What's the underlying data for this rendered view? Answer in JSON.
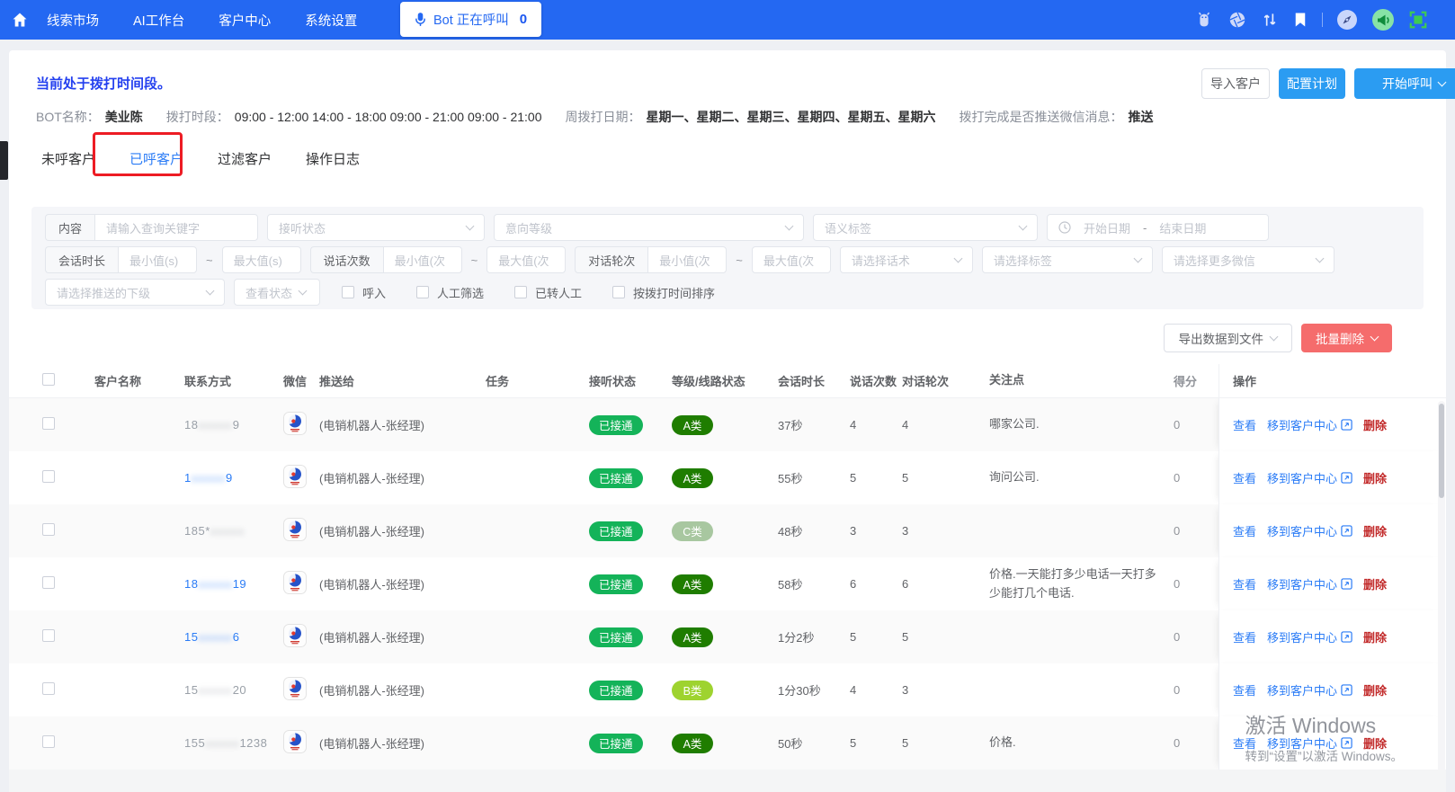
{
  "colors": {
    "nav": "#2468f2",
    "accent_blue": "#2b7cf6",
    "answered_green": "#14b359",
    "delete_red": "#f56c6c",
    "annotation_red": "#ed1c24",
    "grades": {
      "A类": "#1f7d00",
      "B类": "#9ed32f",
      "C类": "#a8c7a0"
    }
  },
  "nav": {
    "items": [
      "线索市场",
      "AI工作台",
      "客户中心",
      "系统设置"
    ],
    "bot": {
      "label": "Bot 正在呼叫",
      "count": "0"
    },
    "right_icons": [
      "android-icon",
      "aperture-icon",
      "sort-arrows-icon",
      "bookmark-icon",
      "compass-icon",
      "megaphone-icon",
      "screenshot-icon"
    ]
  },
  "toolbar": {
    "status": "当前处于拨打时间段。",
    "import": "导入客户",
    "configure": "配置计划",
    "start": "开始呼叫"
  },
  "bot_info": {
    "name_label": "BOT名称：",
    "name": "美业陈",
    "period_label": "拨打时段：",
    "period": "09:00 - 12:00 14:00 - 18:00 09:00 - 21:00 09:00 - 21:00",
    "weekdays_label": "周拨打日期：",
    "weekdays": "星期一、星期二、星期三、星期四、星期五、星期六",
    "push_label": "拨打完成是否推送微信消息：",
    "push_value": "推送"
  },
  "tabs": [
    {
      "label": "未呼客户",
      "active": false
    },
    {
      "label": "已呼客户",
      "active": true
    },
    {
      "label": "过滤客户",
      "active": false
    },
    {
      "label": "操作日志",
      "active": false
    }
  ],
  "filters": {
    "content_label": "内容",
    "content_placeholder": "请输入查询关键字",
    "answer_status": "接听状态",
    "intent_level": "意向等级",
    "semantic_tag": "语义标签",
    "start_date": "开始日期",
    "date_sep": "-",
    "end_date": "结束日期",
    "duration_label": "会话时长",
    "min_s": "最小值(s)",
    "max_s": "最大值(s)",
    "tilde": "~",
    "speak_label": "说话次数",
    "min_times": "最小值(次",
    "max_times": "最大值(次",
    "rounds_label": "对话轮次",
    "script_select": "请选择话术",
    "tag_select": "请选择标签",
    "more_wechat_select": "请选择更多微信",
    "push_sub_select": "请选择推送的下级",
    "view_status_select": "查看状态",
    "checkboxes": [
      "呼入",
      "人工筛选",
      "已转人工",
      "按拨打时间排序"
    ]
  },
  "table": {
    "export_label": "导出数据到文件",
    "delete_label": "批量删除",
    "headers": [
      "客户名称",
      "联系方式",
      "微信",
      "推送给",
      "任务",
      "接听状态",
      "等级/线路状态",
      "会话时长",
      "说话次数",
      "对话轮次",
      "关注点",
      "得分",
      "操作"
    ],
    "actions": {
      "view": "查看",
      "move": "移到客户中心",
      "del": "删除"
    },
    "rows": [
      {
        "phone_prefix": "18",
        "phone_suffix": "9",
        "phone_blue": false,
        "push_to": "(电销机器人-张经理)",
        "status": "已接通",
        "grade": "A类",
        "duration": "37秒",
        "speak": "4",
        "rounds": "4",
        "focus": "哪家公司.",
        "score": "0"
      },
      {
        "phone_prefix": "1",
        "phone_suffix": "9",
        "phone_blue": true,
        "push_to": "(电销机器人-张经理)",
        "status": "已接通",
        "grade": "A类",
        "duration": "55秒",
        "speak": "5",
        "rounds": "5",
        "focus": "询问公司.",
        "score": "0"
      },
      {
        "phone_prefix": "185*",
        "phone_suffix": "",
        "phone_blue": false,
        "push_to": "(电销机器人-张经理)",
        "status": "已接通",
        "grade": "C类",
        "duration": "48秒",
        "speak": "3",
        "rounds": "3",
        "focus": "",
        "score": "0"
      },
      {
        "phone_prefix": "18",
        "phone_suffix": "19",
        "phone_blue": true,
        "push_to": "(电销机器人-张经理)",
        "status": "已接通",
        "grade": "A类",
        "duration": "58秒",
        "speak": "6",
        "rounds": "6",
        "focus": "价格.一天能打多少电话一天打多少能打几个电话.",
        "score": "0"
      },
      {
        "phone_prefix": "15",
        "phone_suffix": "6",
        "phone_blue": true,
        "push_to": "(电销机器人-张经理)",
        "status": "已接通",
        "grade": "A类",
        "duration": "1分2秒",
        "speak": "5",
        "rounds": "5",
        "focus": "",
        "score": "0"
      },
      {
        "phone_prefix": "15",
        "phone_suffix": "20",
        "phone_blue": false,
        "push_to": "(电销机器人-张经理)",
        "status": "已接通",
        "grade": "B类",
        "duration": "1分30秒",
        "speak": "4",
        "rounds": "3",
        "focus": "",
        "score": "0"
      },
      {
        "phone_prefix": "155",
        "phone_suffix": "1238",
        "phone_blue": false,
        "push_to": "(电销机器人-张经理)",
        "status": "已接通",
        "grade": "A类",
        "duration": "50秒",
        "speak": "5",
        "rounds": "5",
        "focus": "价格.",
        "score": "0"
      }
    ]
  },
  "watermark": {
    "line1": "激活 Windows",
    "line2": "转到“设置”以激活 Windows。"
  }
}
